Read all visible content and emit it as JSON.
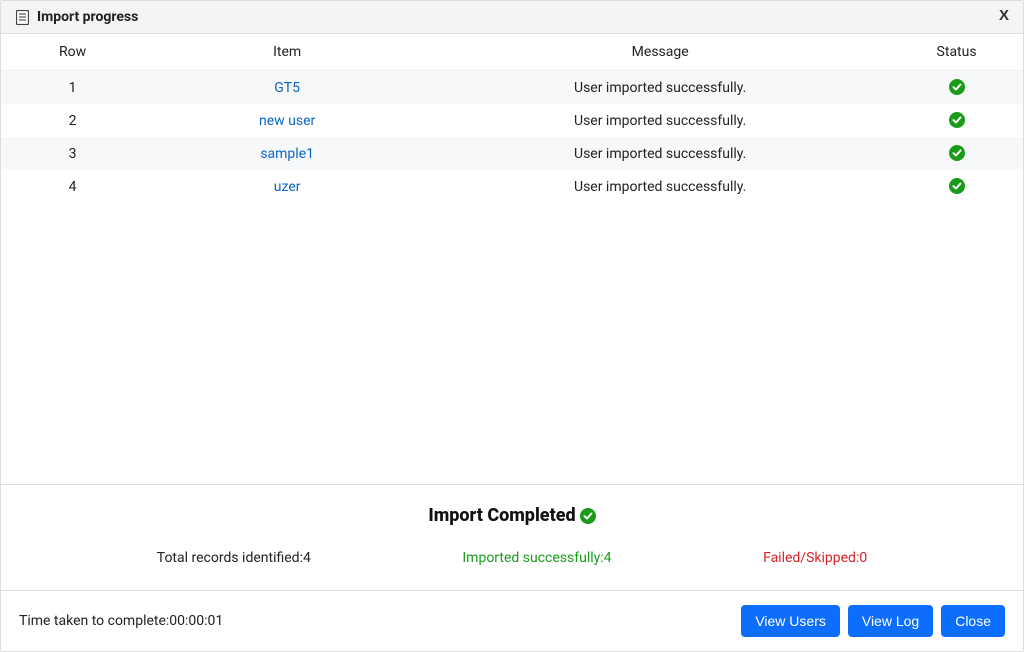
{
  "header": {
    "title": "Import progress",
    "close": "X"
  },
  "table": {
    "headers": {
      "row": "Row",
      "item": "Item",
      "message": "Message",
      "status": "Status"
    },
    "rows": [
      {
        "row": "1",
        "item": "GT5",
        "message": "User imported successfully.",
        "status": "ok"
      },
      {
        "row": "2",
        "item": "new user",
        "message": "User imported successfully.",
        "status": "ok"
      },
      {
        "row": "3",
        "item": "sample1",
        "message": "User imported successfully.",
        "status": "ok"
      },
      {
        "row": "4",
        "item": "uzer",
        "message": "User imported successfully.",
        "status": "ok"
      }
    ]
  },
  "summary": {
    "title": "Import Completed",
    "total_label": "Total records identified:",
    "total_value": "4",
    "success_label": "Imported successfully:",
    "success_value": "4",
    "fail_label": "Failed/Skipped:",
    "fail_value": "0"
  },
  "footer": {
    "time_label": "Time taken to complete:",
    "time_value": "00:00:01",
    "buttons": {
      "view_users": "View Users",
      "view_log": "View Log",
      "close": "Close"
    }
  }
}
